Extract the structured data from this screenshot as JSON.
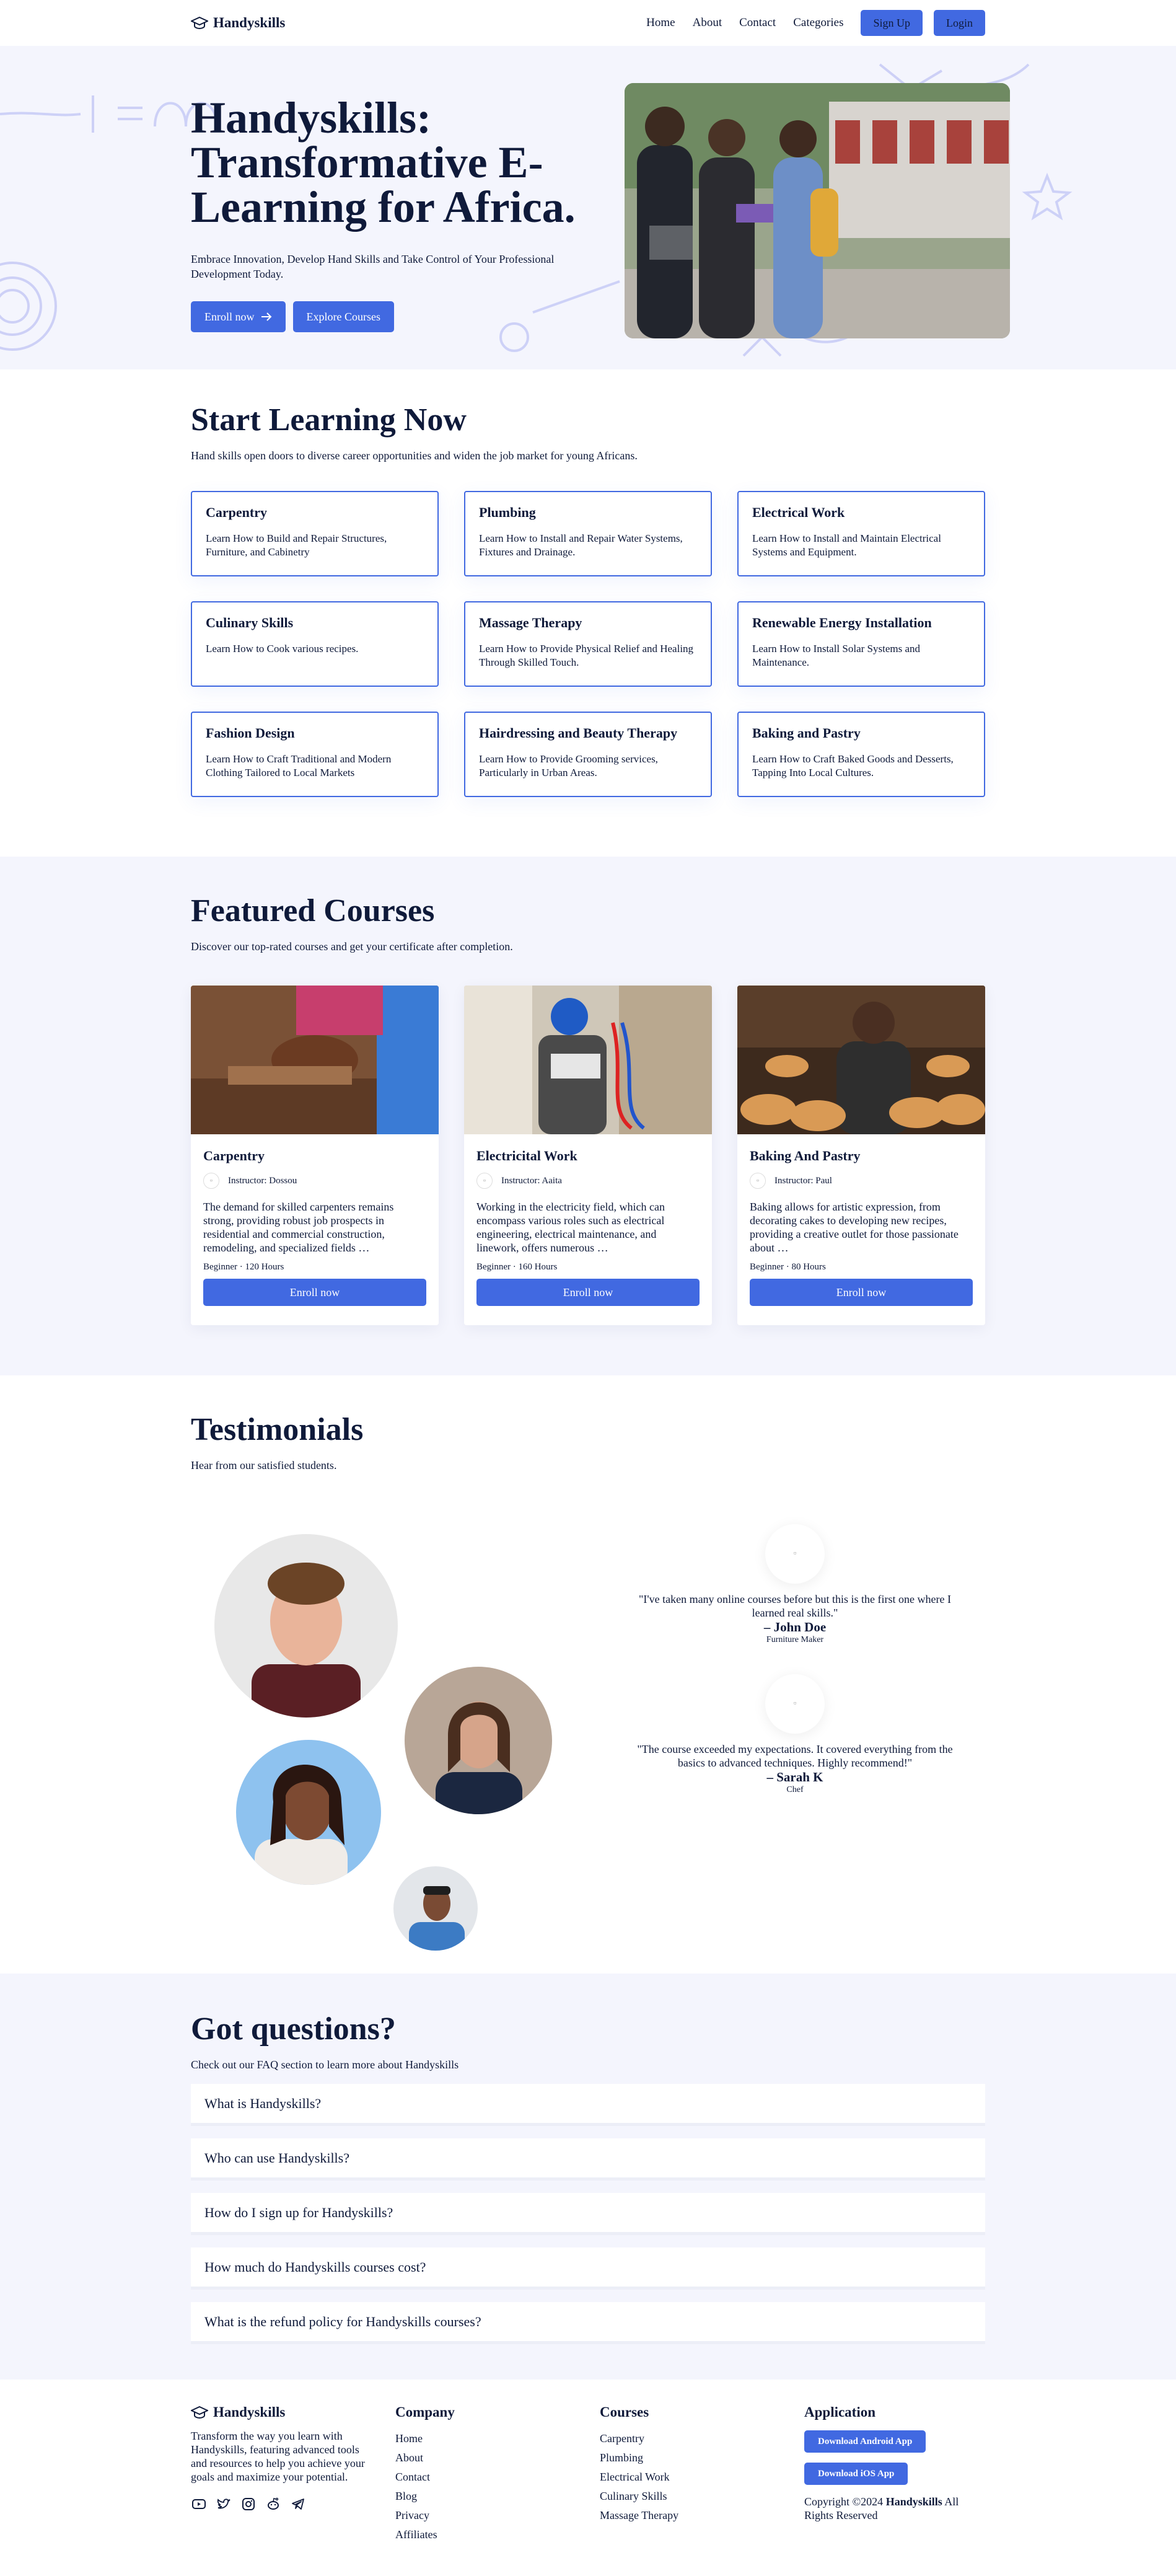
{
  "brand": {
    "name": "Handyskills"
  },
  "nav": {
    "links": [
      "Home",
      "About",
      "Contact",
      "Categories"
    ],
    "signup": "Sign Up",
    "login": "Login"
  },
  "hero": {
    "title": "Handyskills: Transformative E-Learning for Africa.",
    "subtitle": "Embrace Innovation, Develop Hand Skills and Take Control of Your Professional Development Today.",
    "enroll": "Enroll now",
    "explore": "Explore Courses"
  },
  "learn": {
    "title": "Start Learning Now",
    "subtitle": "Hand skills open doors to diverse career opportunities and widen the job market for young Africans.",
    "skills": [
      {
        "title": "Carpentry",
        "desc": "Learn How to Build and Repair Structures, Furniture, and Cabinetry"
      },
      {
        "title": "Plumbing",
        "desc": "Learn How to Install and Repair Water Systems, Fixtures and Drainage."
      },
      {
        "title": "Electrical Work",
        "desc": "Learn How to Install and Maintain Electrical Systems and Equipment."
      },
      {
        "title": "Culinary Skills",
        "desc": "Learn How to Cook various recipes."
      },
      {
        "title": "Massage Therapy",
        "desc": "Learn How to Provide Physical Relief and Healing Through Skilled Touch."
      },
      {
        "title": "Renewable Energy Installation",
        "desc": "Learn How to Install Solar Systems and Maintenance."
      },
      {
        "title": "Fashion Design",
        "desc": "Learn How to Craft Traditional and Modern Clothing Tailored to Local Markets"
      },
      {
        "title": "Hairdressing and Beauty Therapy",
        "desc": "Learn How to Provide Grooming services, Particularly in Urban Areas."
      },
      {
        "title": "Baking and Pastry",
        "desc": "Learn How to Craft Baked Goods and Desserts, Tapping Into Local Cultures."
      }
    ]
  },
  "featured": {
    "title": "Featured Courses",
    "subtitle": "Discover our top-rated courses and get your certificate after completion.",
    "courses": [
      {
        "title": "Carpentry",
        "instructor": "Instructor: Dossou",
        "desc": "The demand for skilled carpenters remains strong, providing robust job prospects in residential and commercial construction, remodeling, and specialized fields …",
        "meta": "Beginner · 120 Hours",
        "cta": "Enroll now"
      },
      {
        "title": "Electricital Work",
        "instructor": "Instructor: Aaita",
        "desc": "Working in the electricity field, which can encompass various roles such as electrical engineering, electrical maintenance, and linework, offers numerous …",
        "meta": "Beginner · 160 Hours",
        "cta": "Enroll now"
      },
      {
        "title": "Baking And Pastry",
        "instructor": "Instructor: Paul",
        "desc": "Baking allows for artistic expression, from decorating cakes to developing new recipes, providing a creative outlet for those passionate about …",
        "meta": "Beginner · 80 Hours",
        "cta": "Enroll now"
      }
    ]
  },
  "testimonials": {
    "title": "Testimonials",
    "subtitle": "Hear from our satisfied students.",
    "items": [
      {
        "quote": "\"I've taken many online courses before but this is the first one where I learned real skills.\"",
        "name": "– John Doe",
        "role": "Furniture Maker"
      },
      {
        "quote": "\"The course exceeded my expectations. It covered everything from the basics to advanced techniques. Highly recommend!\"",
        "name": "– Sarah K",
        "role": "Chef"
      }
    ]
  },
  "faq": {
    "title": "Got questions?",
    "subtitle": "Check out our FAQ section to learn more about Handyskills",
    "items": [
      "What is Handyskills?",
      "Who can use Handyskills?",
      "How do I sign up for Handyskills?",
      "How much do Handyskills courses cost?",
      "What is the refund policy for Handyskills courses?"
    ]
  },
  "footer": {
    "desc": "Transform the way you learn with Handyskills, featuring advanced tools and resources to help you achieve your goals and maximize your potential.",
    "company_title": "Company",
    "company_links": [
      "Home",
      "About",
      "Contact",
      "Blog",
      "Privacy",
      "Affiliates"
    ],
    "courses_title": "Courses",
    "courses_links": [
      "Carpentry",
      "Plumbing",
      "Electrical Work",
      "Culinary Skills",
      "Massage Therapy"
    ],
    "app_title": "Application",
    "android": "Download Android App",
    "ios": "Download iOS App",
    "copyright_prefix": "Copyright ©2024 ",
    "copyright_brand": "Handyskills",
    "copyright_suffix": " All Rights Reserved",
    "social_icons": [
      "youtube-icon",
      "twitter-icon",
      "instagram-icon",
      "reddit-icon",
      "telegram-icon"
    ]
  },
  "colors": {
    "accent": "#4169e1",
    "navy": "#0f1a3a",
    "tint": "#f4f5fd"
  }
}
